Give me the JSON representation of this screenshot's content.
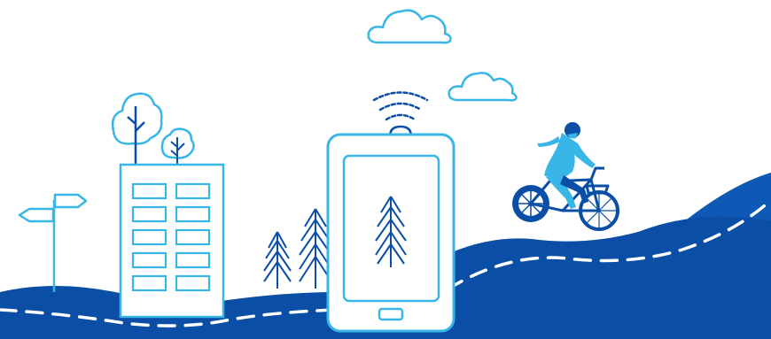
{
  "colors": {
    "background": "#ffffff",
    "hill": "#0a4ea6",
    "hill_back": "#0d59b5",
    "outline_light": "#38b6e8",
    "outline_dark": "#0a4ea6",
    "dash": "#ffffff"
  },
  "icons": [
    "cloud-icon",
    "wifi-signal-icon",
    "tablet-icon",
    "pine-tree-icon",
    "deciduous-tree-icon",
    "building-icon",
    "signpost-icon",
    "cyclist-icon",
    "bicycle-icon"
  ]
}
